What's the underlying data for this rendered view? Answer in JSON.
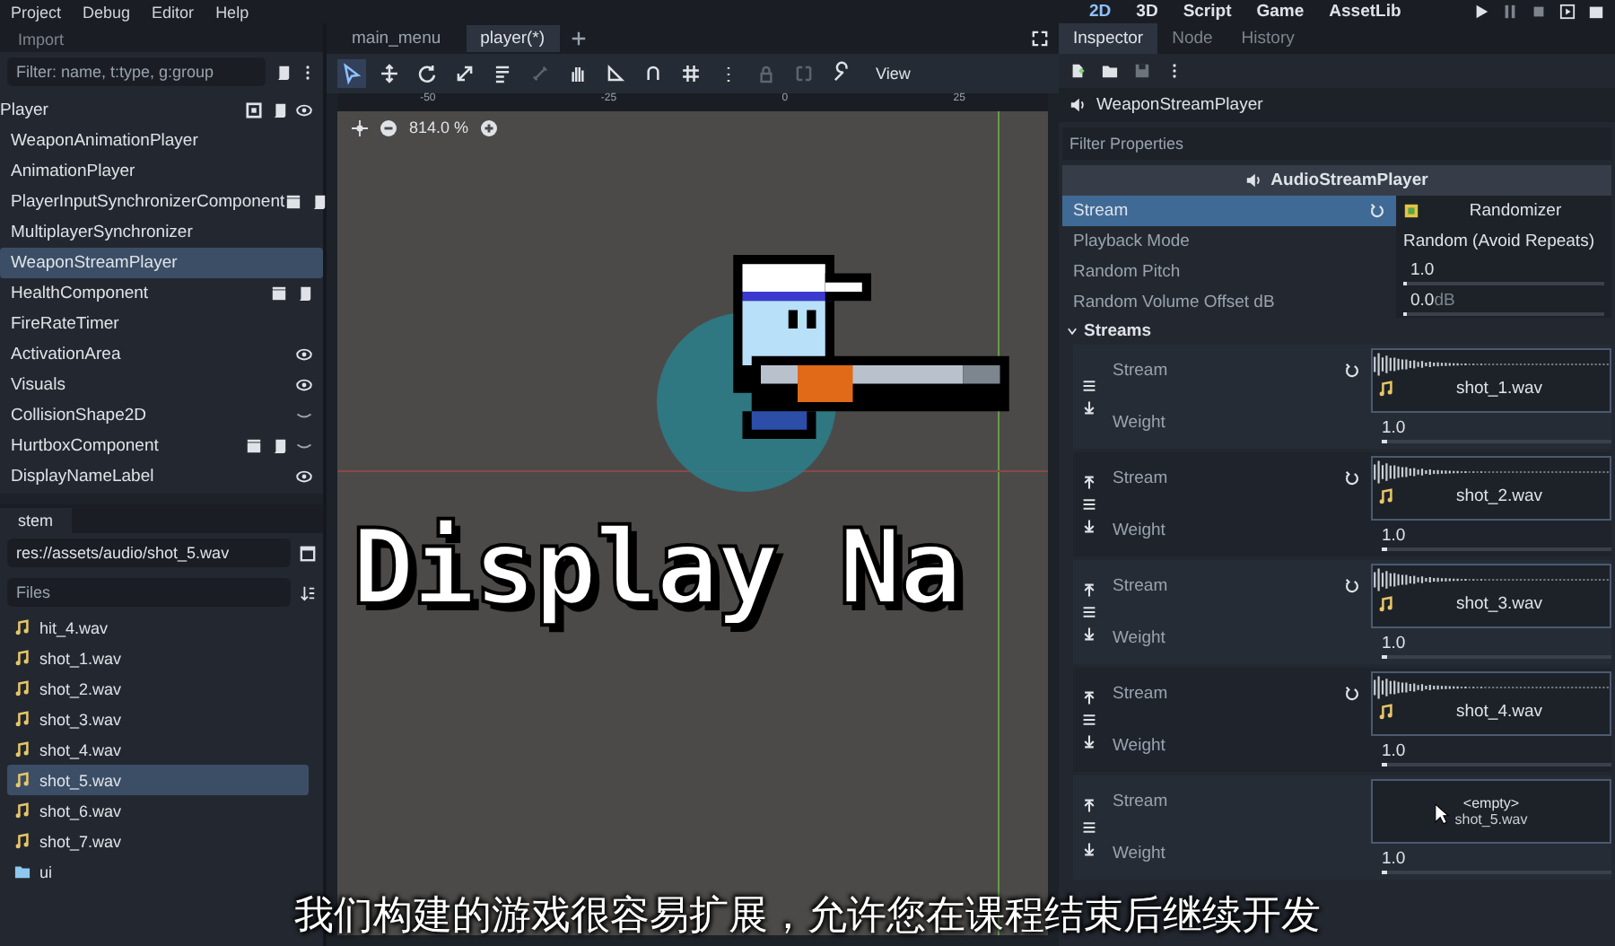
{
  "menu": [
    "Project",
    "Debug",
    "Editor",
    "Help"
  ],
  "workspaces": [
    {
      "label": "2D",
      "selected": true
    },
    {
      "label": "3D",
      "selected": false
    },
    {
      "label": "Script",
      "selected": false
    },
    {
      "label": "Game",
      "selected": false
    },
    {
      "label": "AssetLib",
      "selected": false
    }
  ],
  "scene_dock": {
    "tab": "Import",
    "filter_placeholder": "Filter: name, t:type, g:group",
    "root": {
      "name": "Player",
      "selected": false,
      "unique": true,
      "instanced": false,
      "script": true,
      "visible": true,
      "children": [
        {
          "name": "WeaponAnimationPlayer",
          "selected": false,
          "unique": false,
          "instanced": false,
          "script": false
        },
        {
          "name": "AnimationPlayer",
          "selected": false,
          "unique": false,
          "instanced": false,
          "script": false
        },
        {
          "name": "PlayerInputSynchronizerComponent",
          "selected": false,
          "unique": false,
          "instanced": true,
          "script": true
        },
        {
          "name": "MultiplayerSynchronizer",
          "selected": false,
          "unique": false,
          "instanced": false,
          "script": false
        },
        {
          "name": "WeaponStreamPlayer",
          "selected": true,
          "unique": false,
          "instanced": false,
          "script": false
        },
        {
          "name": "HealthComponent",
          "selected": false,
          "unique": false,
          "instanced": true,
          "script": true
        },
        {
          "name": "FireRateTimer",
          "selected": false,
          "unique": false,
          "instanced": false,
          "script": false
        },
        {
          "name": "ActivationArea",
          "selected": false,
          "unique": false,
          "instanced": false,
          "script": false,
          "visible": true
        },
        {
          "name": "Visuals",
          "selected": false,
          "unique": false,
          "instanced": false,
          "script": false,
          "visible": true
        },
        {
          "name": "CollisionShape2D",
          "selected": false,
          "unique": false,
          "instanced": false,
          "script": false,
          "visible": false
        },
        {
          "name": "HurtboxComponent",
          "selected": false,
          "unique": false,
          "instanced": true,
          "script": true,
          "visible": false
        },
        {
          "name": "DisplayNameLabel",
          "selected": false,
          "unique": false,
          "instanced": false,
          "script": false,
          "visible": true
        }
      ]
    }
  },
  "filesystem": {
    "tab": "stem",
    "path": "res://assets/audio/shot_5.wav",
    "filter_placeholder": "Files",
    "files": [
      {
        "name": "hit_4.wav",
        "kind": "audio",
        "selected": false
      },
      {
        "name": "shot_1.wav",
        "kind": "audio",
        "selected": false
      },
      {
        "name": "shot_2.wav",
        "kind": "audio",
        "selected": false
      },
      {
        "name": "shot_3.wav",
        "kind": "audio",
        "selected": false
      },
      {
        "name": "shot_4.wav",
        "kind": "audio",
        "selected": false
      },
      {
        "name": "shot_5.wav",
        "kind": "audio",
        "selected": true
      },
      {
        "name": "shot_6.wav",
        "kind": "audio",
        "selected": false
      },
      {
        "name": "shot_7.wav",
        "kind": "audio",
        "selected": false
      },
      {
        "name": "ui",
        "kind": "folder",
        "selected": false
      }
    ]
  },
  "editor_tabs": [
    {
      "label": "main_menu",
      "selected": false
    },
    {
      "label": "player(*)",
      "selected": true
    }
  ],
  "canvas_toolbar": {
    "tools": [
      {
        "selected": true,
        "disabled": false
      },
      {
        "selected": false,
        "disabled": false
      },
      {
        "selected": false,
        "disabled": false
      },
      {
        "selected": false,
        "disabled": false
      },
      {
        "selected": false,
        "disabled": false
      },
      {
        "selected": false,
        "disabled": true
      },
      {
        "selected": false,
        "disabled": false
      },
      {
        "selected": false,
        "disabled": false
      },
      {
        "selected": false,
        "disabled": false
      },
      {
        "selected": false,
        "disabled": false
      },
      {
        "selected": false,
        "disabled": false
      },
      {
        "selected": false,
        "disabled": true
      },
      {
        "selected": false,
        "disabled": true
      },
      {
        "selected": false,
        "disabled": false
      }
    ],
    "view_button": "View"
  },
  "viewport": {
    "ruler_labels": [
      "-50",
      "-25",
      "0",
      "25"
    ],
    "zoom": "814.0 %",
    "label_text": "Display Na"
  },
  "inspector": {
    "tabs": [
      {
        "label": "Inspector",
        "selected": true
      },
      {
        "label": "Node",
        "selected": false
      },
      {
        "label": "History",
        "selected": false
      }
    ],
    "node": "WeaponStreamPlayer",
    "filter_placeholder": "Filter Properties",
    "class": "AudioStreamPlayer",
    "stream": {
      "label": "Stream",
      "selected": true,
      "value": "Randomizer"
    },
    "properties": [
      {
        "label": "Playback Mode",
        "kind": "text",
        "value": "Random (Avoid Repeats)"
      },
      {
        "label": "Random Pitch",
        "kind": "slider",
        "value": "1.0",
        "level": 0.0
      },
      {
        "label": "Random Volume Offset dB",
        "kind": "slider",
        "value": "0.0",
        "unit": "dB",
        "level": 0.0
      }
    ],
    "section": {
      "label": "Streams",
      "expanded": true
    },
    "streams": [
      {
        "stream_label": "Stream",
        "file": "shot_1.wav",
        "weight_label": "Weight",
        "weight": "1.0",
        "level": 0.0,
        "can_move_up": false
      },
      {
        "stream_label": "Stream",
        "file": "shot_2.wav",
        "weight_label": "Weight",
        "weight": "1.0",
        "level": 0.0,
        "can_move_up": true
      },
      {
        "stream_label": "Stream",
        "file": "shot_3.wav",
        "weight_label": "Weight",
        "weight": "1.0",
        "level": 0.0,
        "can_move_up": true
      },
      {
        "stream_label": "Stream",
        "file": "shot_4.wav",
        "weight_label": "Weight",
        "weight": "1.0",
        "level": 0.0,
        "can_move_up": true
      },
      {
        "stream_label": "Stream",
        "file": "<empty>",
        "drag_ghost": "shot_5.wav",
        "weight_label": "Weight",
        "weight": "1.0",
        "level": 0.0,
        "can_move_up": true
      }
    ]
  },
  "subtitle": "我们构建的游戏很容易扩展，允许您在课程结束后继续开发"
}
